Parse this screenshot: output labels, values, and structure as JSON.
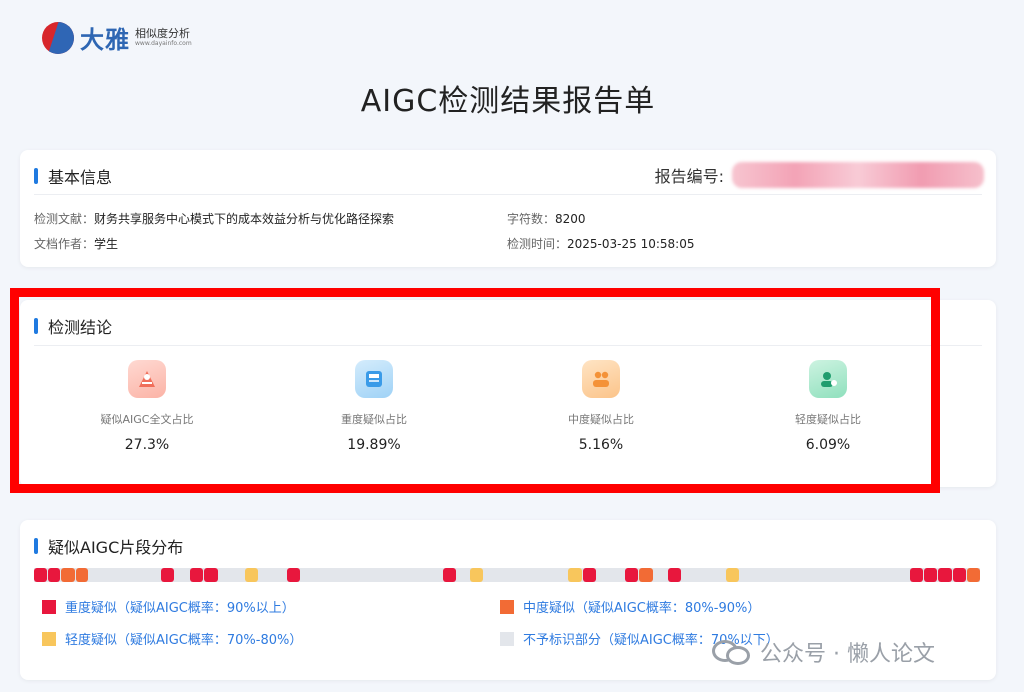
{
  "logo": {
    "brand": "大雅",
    "subtitle": "相似度分析",
    "url": "www.dayainfo.com"
  },
  "page_title": "AIGC检测结果报告单",
  "basic_info": {
    "heading": "基本信息",
    "report_no_label": "报告编号:",
    "fields": [
      {
        "key": "检测文献：",
        "value": "财务共享服务中心模式下的成本效益分析与优化路径探索"
      },
      {
        "key": "字符数：",
        "value": "8200"
      },
      {
        "key": "文档作者：",
        "value": "学生"
      },
      {
        "key": "检测时间：",
        "value": "2025-03-25 10:58:05"
      }
    ]
  },
  "conclusion": {
    "heading": "检测结论",
    "metrics": [
      {
        "label": "疑似AIGC全文占比",
        "value": "27.3%",
        "icon": "aigc-portion-icon",
        "color": "#f06e5a"
      },
      {
        "label": "重度疑似占比",
        "value": "19.89%",
        "icon": "heavy-suspect-icon",
        "color": "#3a9be8"
      },
      {
        "label": "中度疑似占比",
        "value": "5.16%",
        "icon": "medium-suspect-icon",
        "color": "#f49238"
      },
      {
        "label": "轻度疑似占比",
        "value": "6.09%",
        "icon": "light-suspect-icon",
        "color": "#2dbd8a"
      }
    ]
  },
  "distribution": {
    "heading": "疑似AIGC片段分布",
    "colors": {
      "heavy": "#e8173d",
      "medium": "#f26b35",
      "light": "#f8c65c",
      "none": "#e3e6eb"
    },
    "segments": [
      {
        "start": 0.0,
        "end": 0.014,
        "level": "heavy"
      },
      {
        "start": 0.015,
        "end": 0.028,
        "level": "heavy"
      },
      {
        "start": 0.029,
        "end": 0.043,
        "level": "medium"
      },
      {
        "start": 0.044,
        "end": 0.057,
        "level": "medium"
      },
      {
        "start": 0.134,
        "end": 0.148,
        "level": "heavy"
      },
      {
        "start": 0.165,
        "end": 0.179,
        "level": "heavy"
      },
      {
        "start": 0.18,
        "end": 0.194,
        "level": "heavy"
      },
      {
        "start": 0.223,
        "end": 0.237,
        "level": "light"
      },
      {
        "start": 0.267,
        "end": 0.281,
        "level": "heavy"
      },
      {
        "start": 0.432,
        "end": 0.446,
        "level": "heavy"
      },
      {
        "start": 0.461,
        "end": 0.475,
        "level": "light"
      },
      {
        "start": 0.565,
        "end": 0.579,
        "level": "light"
      },
      {
        "start": 0.58,
        "end": 0.594,
        "level": "heavy"
      },
      {
        "start": 0.625,
        "end": 0.639,
        "level": "heavy"
      },
      {
        "start": 0.64,
        "end": 0.654,
        "level": "medium"
      },
      {
        "start": 0.67,
        "end": 0.684,
        "level": "heavy"
      },
      {
        "start": 0.731,
        "end": 0.745,
        "level": "light"
      },
      {
        "start": 0.926,
        "end": 0.94,
        "level": "heavy"
      },
      {
        "start": 0.941,
        "end": 0.955,
        "level": "heavy"
      },
      {
        "start": 0.956,
        "end": 0.97,
        "level": "heavy"
      },
      {
        "start": 0.971,
        "end": 0.985,
        "level": "heavy"
      },
      {
        "start": 0.986,
        "end": 1.0,
        "level": "medium"
      }
    ],
    "legend": [
      {
        "label": "重度疑似（疑似AIGC概率：90%以上）",
        "level": "heavy"
      },
      {
        "label": "中度疑似（疑似AIGC概率：80%-90%）",
        "level": "medium"
      },
      {
        "label": "轻度疑似（疑似AIGC概率：70%-80%）",
        "level": "light"
      },
      {
        "label": "不予标识部分（疑似AIGC概率：70%以下）",
        "level": "none"
      }
    ]
  },
  "watermark": "公众号 · 懒人论文"
}
